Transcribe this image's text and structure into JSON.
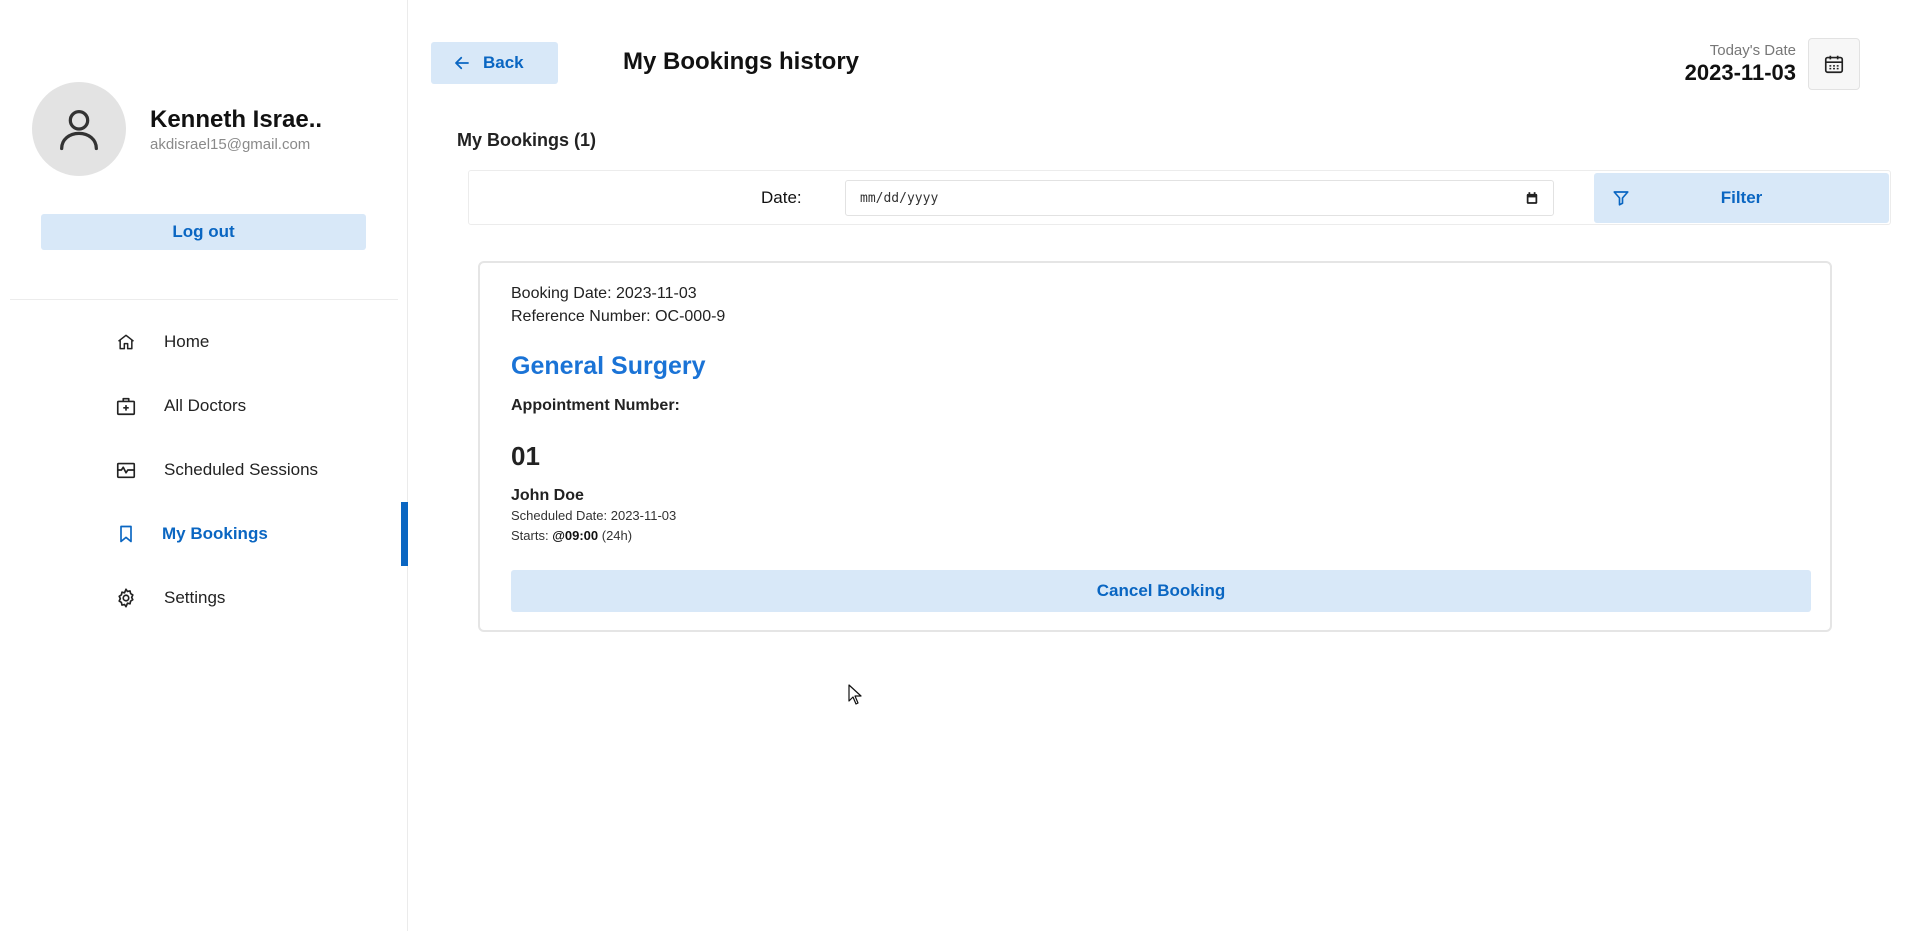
{
  "profile": {
    "name": "Kenneth Israe..",
    "email": "akdisrael15@gmail.com",
    "logout_label": "Log out"
  },
  "nav": {
    "items": [
      {
        "label": "Home",
        "icon": "home-icon"
      },
      {
        "label": "All Doctors",
        "icon": "medical-bag-icon"
      },
      {
        "label": "Scheduled Sessions",
        "icon": "schedule-icon"
      },
      {
        "label": "My Bookings",
        "icon": "bookmark-icon",
        "active": true
      },
      {
        "label": "Settings",
        "icon": "gear-icon"
      }
    ]
  },
  "header": {
    "back_label": "Back",
    "title": "My Bookings history",
    "today_label": "Today's Date",
    "today_value": "2023-11-03"
  },
  "bookings": {
    "section_title": "My Bookings (1)"
  },
  "filter": {
    "date_label": "Date:",
    "date_placeholder": "mm/dd/yyyy",
    "button_label": "Filter"
  },
  "booking_card": {
    "booking_date": "Booking Date: 2023-11-03",
    "reference": "Reference Number: OC-000-9",
    "specialty": "General Surgery",
    "appointment_label": "Appointment Number:",
    "appointment_number": "01",
    "doctor": "John Doe",
    "scheduled_date": "Scheduled Date: 2023-11-03",
    "starts_prefix": "Starts: ",
    "starts_time": "@09:00",
    "starts_suffix": " (24h)",
    "cancel_label": "Cancel Booking"
  },
  "colors": {
    "accent": "#0a66c2",
    "accent_light": "#d8e8f8",
    "specialty": "#1a73d6"
  }
}
